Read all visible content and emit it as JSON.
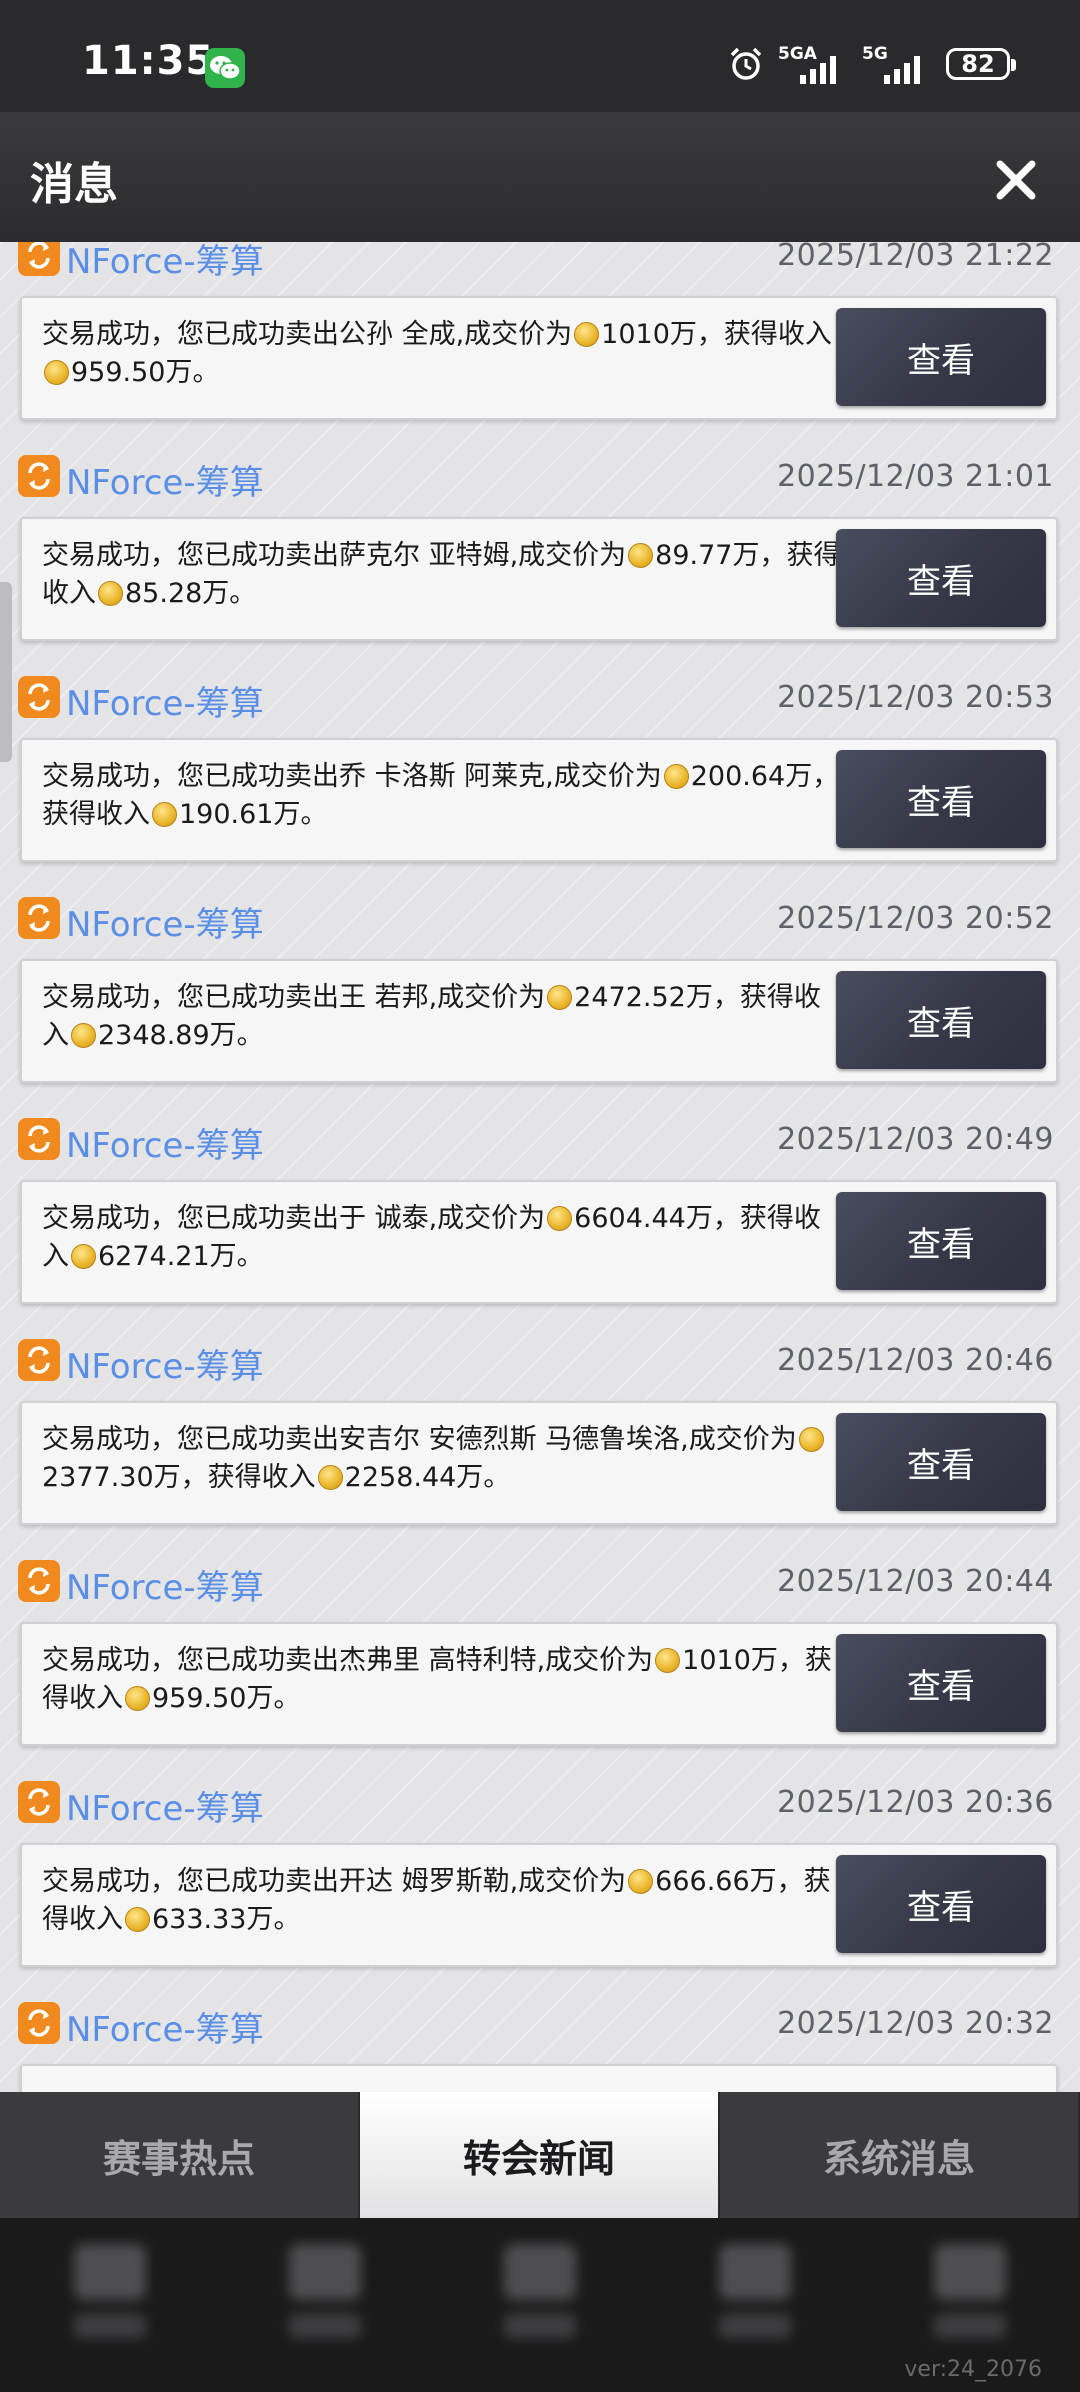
{
  "status_bar": {
    "time": "11:35",
    "network1": "5GA",
    "network2": "5G",
    "battery": "82"
  },
  "header": {
    "title": "消息"
  },
  "messages": [
    {
      "source": "NForce-筹算",
      "time": "2025/12/03 21:22",
      "pre": "交易成功，您已成功卖出公孙 全成,成交价为",
      "price": "1010万",
      "mid": "，获得收入",
      "income": "959.50万",
      "post": "。",
      "button": "查看"
    },
    {
      "source": "NForce-筹算",
      "time": "2025/12/03 21:01",
      "pre": "交易成功，您已成功卖出萨克尔 亚特姆,成交价为",
      "price": "89.77万",
      "mid": "，获得收入",
      "income": "85.28万",
      "post": "。",
      "button": "查看"
    },
    {
      "source": "NForce-筹算",
      "time": "2025/12/03 20:53",
      "pre": "交易成功，您已成功卖出乔 卡洛斯 阿莱克,成交价为",
      "price": "200.64万",
      "mid": "，获得收入",
      "income": "190.61万",
      "post": "。",
      "button": "查看"
    },
    {
      "source": "NForce-筹算",
      "time": "2025/12/03 20:52",
      "pre": "交易成功，您已成功卖出王 若邦,成交价为",
      "price": "2472.52万",
      "mid": "，获得收入",
      "income": "2348.89万",
      "post": "。",
      "button": "查看"
    },
    {
      "source": "NForce-筹算",
      "time": "2025/12/03 20:49",
      "pre": "交易成功，您已成功卖出于 诚泰,成交价为",
      "price": "6604.44万",
      "mid": "，获得收入",
      "income": "6274.21万",
      "post": "。",
      "button": "查看"
    },
    {
      "source": "NForce-筹算",
      "time": "2025/12/03 20:46",
      "pre": "交易成功，您已成功卖出安吉尔 安德烈斯 马德鲁埃洛,成交价为",
      "price": "2377.30万",
      "mid": "，获得收入",
      "income": "2258.44万",
      "post": "。",
      "button": "查看"
    },
    {
      "source": "NForce-筹算",
      "time": "2025/12/03 20:44",
      "pre": "交易成功，您已成功卖出杰弗里 高特利特,成交价为",
      "price": "1010万",
      "mid": "，获得收入",
      "income": "959.50万",
      "post": "。",
      "button": "查看"
    },
    {
      "source": "NForce-筹算",
      "time": "2025/12/03 20:36",
      "pre": "交易成功，您已成功卖出开达 姆罗斯勒,成交价为",
      "price": "666.66万",
      "mid": "，获得收入",
      "income": "633.33万",
      "post": "。",
      "button": "查看"
    },
    {
      "source": "NForce-筹算",
      "time": "2025/12/03 20:32",
      "pre": "",
      "price": "",
      "mid": "",
      "income": "",
      "post": "",
      "button": ""
    }
  ],
  "tabs": [
    {
      "label": "赛事热点",
      "active": false
    },
    {
      "label": "转会新闻",
      "active": true
    },
    {
      "label": "系统消息",
      "active": false
    }
  ],
  "version": "ver:24_2076"
}
